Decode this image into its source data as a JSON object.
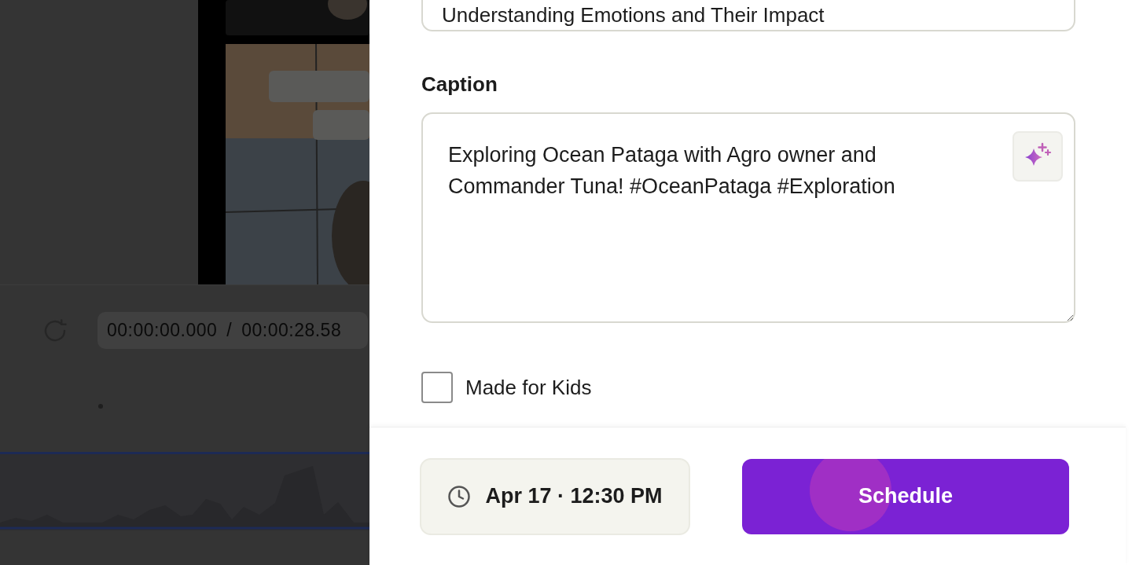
{
  "editor": {
    "timecode": {
      "current": "00:00:00.000",
      "separator": "/",
      "total": "00:00:28.58"
    }
  },
  "panel": {
    "title_field": {
      "value": "Understanding Emotions and Their Impact"
    },
    "caption": {
      "label": "Caption",
      "value": "Exploring Ocean Pataga with Agro owner and Commander Tuna! #OceanPataga #Exploration"
    },
    "made_for_kids": {
      "label": "Made for Kids",
      "checked": false
    },
    "schedule_time": "Apr 17 · 12:30 PM",
    "schedule_button": "Schedule"
  }
}
